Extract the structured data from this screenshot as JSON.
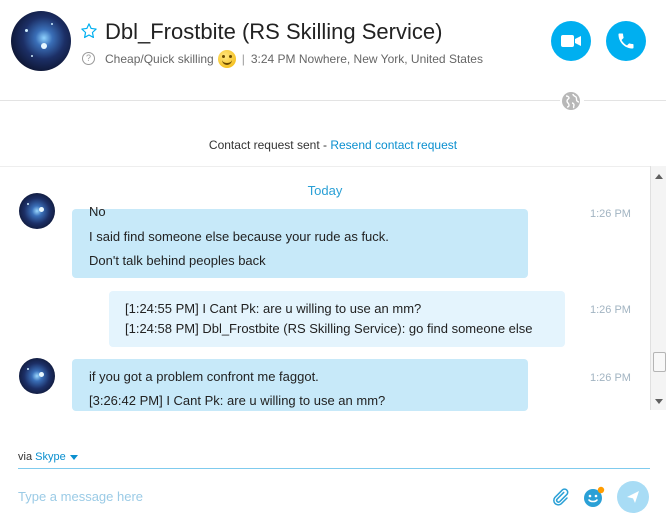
{
  "header": {
    "contact_name": "Dbl_Frostbite (RS Skilling Service)",
    "mood_message": "Cheap/Quick skilling",
    "separator": "|",
    "local_time": "3:24 PM Nowhere, New York, United States",
    "mood_icon": "question-icon",
    "video_icon": "video-camera-icon",
    "call_icon": "phone-icon",
    "favorite_icon": "star-outline-icon",
    "globe_icon": "globe-icon"
  },
  "contact_request": {
    "status_text": "Contact request sent - ",
    "resend_link": "Resend contact request"
  },
  "conversation": {
    "day_label": "Today",
    "messages": [
      {
        "direction": "incoming",
        "lines": [
          "No",
          "I said find someone else because your rude as fuck.",
          "Don't talk behind peoples back"
        ],
        "time": "1:26 PM"
      },
      {
        "direction": "outgoing",
        "lines": [
          "[1:24:55 PM] I Cant Pk: are u willing to use an mm?",
          "[1:24:58 PM] Dbl_Frostbite (RS Skilling Service): go find someone else"
        ],
        "time": "1:26 PM"
      },
      {
        "direction": "incoming",
        "lines": [
          "if you got a problem confront me faggot.",
          "[3:26:42 PM] I Cant Pk: are u willing to use an mm?"
        ],
        "time": "1:26 PM"
      }
    ]
  },
  "composer": {
    "via_label": "via",
    "via_service": "Skype",
    "placeholder": "Type a message here",
    "attach_icon": "paperclip-icon",
    "emoticon_icon": "emoticon-icon",
    "send_icon": "send-icon"
  },
  "colors": {
    "accent": "#00aff0",
    "incoming_bubble": "#c7e9f9",
    "outgoing_bubble": "#e4f4fd",
    "link": "#0a8fcf"
  }
}
